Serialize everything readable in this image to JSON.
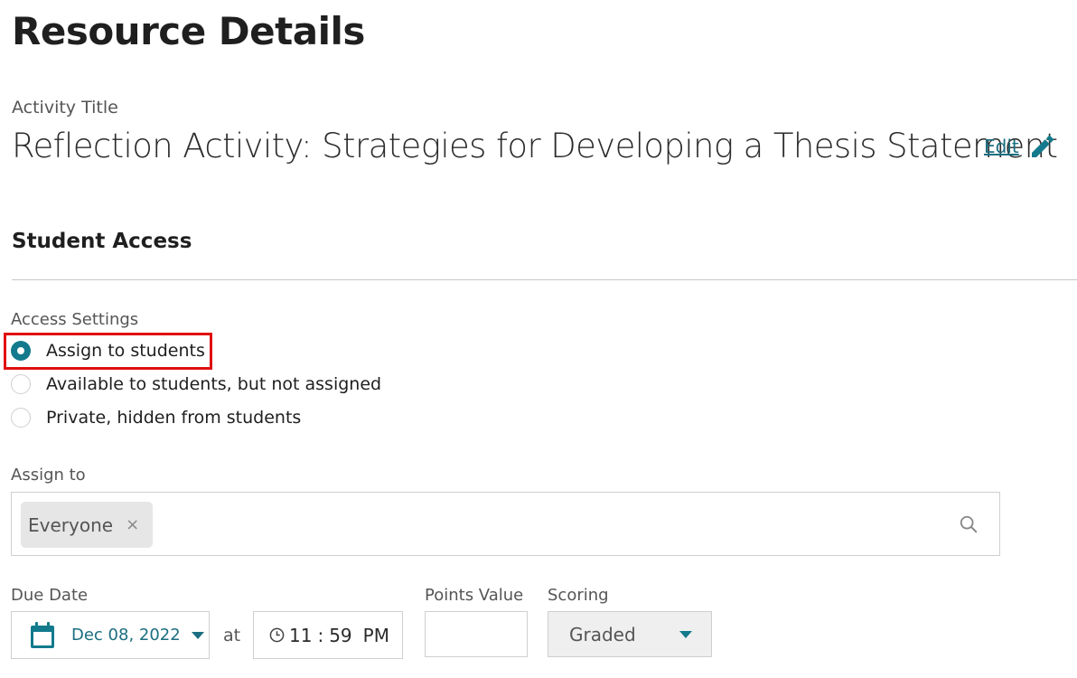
{
  "page": {
    "title": "Resource Details"
  },
  "activity": {
    "label": "Activity Title",
    "title": "Reflection Activity: Strategies for Developing a Thesis Statement",
    "edit_label": "Edit"
  },
  "student_access": {
    "heading": "Student Access",
    "access_settings_label": "Access Settings",
    "options": [
      {
        "label": "Assign to students",
        "selected": true
      },
      {
        "label": "Available to students, but not assigned",
        "selected": false
      },
      {
        "label": "Private, hidden from students",
        "selected": false
      }
    ]
  },
  "assign": {
    "label": "Assign to",
    "chips": [
      {
        "label": "Everyone",
        "remove": "×"
      }
    ]
  },
  "due": {
    "label": "Due Date",
    "date": "Dec 08, 2022",
    "at": "at",
    "hour": "11",
    "sep": ":",
    "minute": "59",
    "ampm": "PM"
  },
  "points": {
    "label": "Points Value",
    "value": ""
  },
  "scoring": {
    "label": "Scoring",
    "value": "Graded"
  },
  "colors": {
    "accent": "#127a8c",
    "link": "#1a6e80",
    "highlight": "#e01010"
  }
}
